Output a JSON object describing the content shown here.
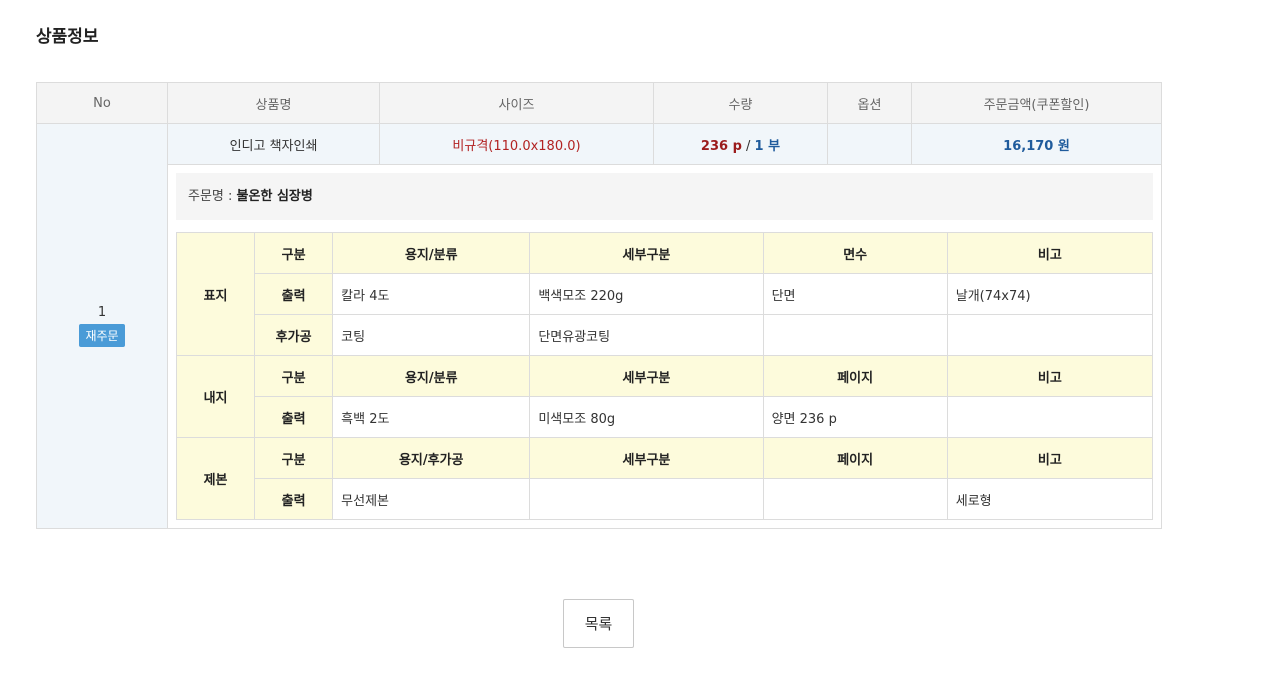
{
  "section_title": "상품정보",
  "table": {
    "headers": {
      "no": "No",
      "product_name": "상품명",
      "size": "사이즈",
      "quantity": "수량",
      "option": "옵션",
      "amount": "주문금액(쿠폰할인)"
    },
    "row": {
      "no": "1",
      "reorder_label": "재주문",
      "product_name": "인디고 책자인쇄",
      "size": "비규격(110.0x180.0)",
      "qty_pages": "236 p",
      "qty_sep": "/",
      "qty_copies": "1 부",
      "option": "",
      "amount": "16,170 원"
    },
    "order_name_label": "주문명 :",
    "order_name_value": "불온한 심장병"
  },
  "spec": {
    "cover": {
      "group": "표지",
      "header": [
        "구분",
        "용지/분류",
        "세부구분",
        "면수",
        "비고"
      ],
      "rows": [
        [
          "출력",
          "칼라 4도",
          "백색모조 220g",
          "단면",
          "날개(74x74)"
        ],
        [
          "후가공",
          "코팅",
          "단면유광코팅",
          "",
          ""
        ]
      ]
    },
    "inner": {
      "group": "내지",
      "header": [
        "구분",
        "용지/분류",
        "세부구분",
        "페이지",
        "비고"
      ],
      "rows": [
        [
          "출력",
          "흑백 2도",
          "미색모조 80g",
          "양면 236 p",
          ""
        ]
      ]
    },
    "binding": {
      "group": "제본",
      "header": [
        "구분",
        "용지/후가공",
        "세부구분",
        "페이지",
        "비고"
      ],
      "rows": [
        [
          "출력",
          "무선제본",
          "",
          "",
          "세로형"
        ]
      ]
    }
  },
  "buttons": {
    "list_label": "목록"
  },
  "colors": {
    "header_bg": "#f4f4f4",
    "product_row_bg": "#f1f6fa",
    "spec_header_bg": "#fdfbdc",
    "reorder_button": "#4a9bd7",
    "size_text": "#b22222",
    "price_text": "#1f5b9c"
  }
}
